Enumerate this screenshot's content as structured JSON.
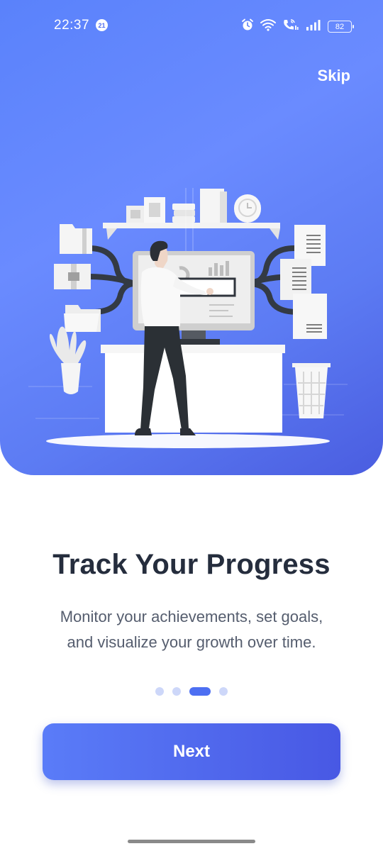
{
  "status_bar": {
    "time": "22:37",
    "notification_badge": "21",
    "battery": "82",
    "icons": [
      "alarm-icon",
      "wifi-icon",
      "volte-call-icon",
      "signal-icon",
      "battery-icon"
    ]
  },
  "header": {
    "skip_label": "Skip"
  },
  "illustration": {
    "icon": "person-at-monitor-illustration"
  },
  "content": {
    "title": "Track Your Progress",
    "subtitle_line1": "Monitor your achievements, set goals,",
    "subtitle_line2": "and visualize your growth over time."
  },
  "pagination": {
    "total": 4,
    "active_index": 2
  },
  "actions": {
    "next_label": "Next"
  },
  "colors": {
    "accent": "#4d6ff2",
    "hero_gradient_start": "#5a82fb",
    "hero_gradient_end": "#4a5de0",
    "title_text": "#252d3d",
    "body_text": "#555d6e",
    "dot_inactive": "#cdd7f9"
  }
}
